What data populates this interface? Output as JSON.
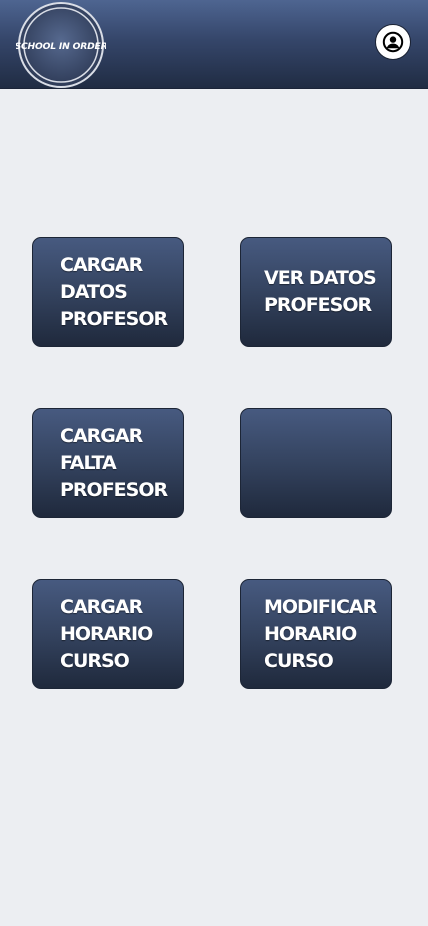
{
  "header": {
    "logo_text": "SCHOOL IN ORDER",
    "user_icon": "user-circle-icon"
  },
  "tiles": [
    {
      "label": "CARGAR\nDATOS\nPROFESOR"
    },
    {
      "label": "VER DATOS\nPROFESOR"
    },
    {
      "label": "CARGAR\nFALTA\nPROFESOR"
    },
    {
      "label": ""
    },
    {
      "label": "CARGAR\nHORARIO\nCURSO"
    },
    {
      "label": "MODIFICAR\nHORARIO\nCURSO"
    }
  ],
  "colors": {
    "header_top": "#4e6591",
    "header_bottom": "#202c43",
    "tile_top": "#475a80",
    "tile_bottom": "#1f293c",
    "background": "#eceef2"
  }
}
